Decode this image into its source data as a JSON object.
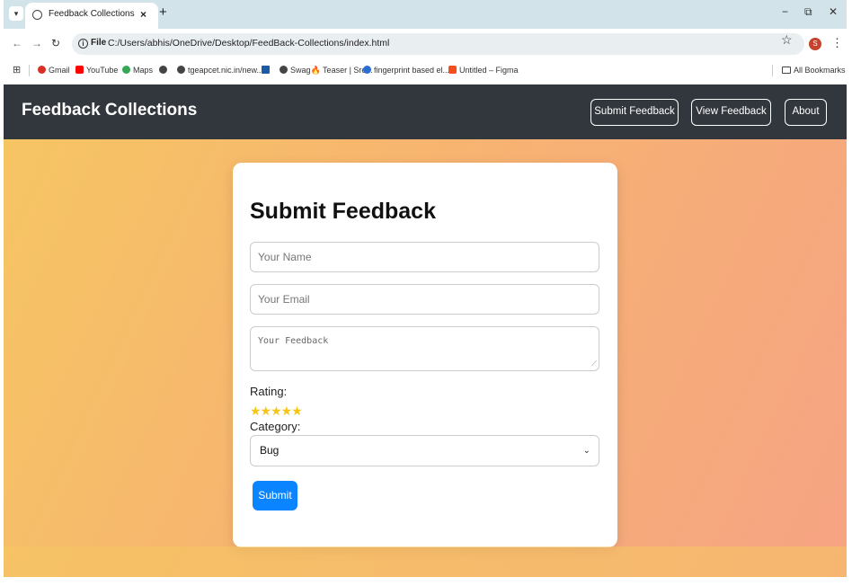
{
  "browser": {
    "tab_title": "Feedback Collections",
    "tab_close": "×",
    "new_tab": "+",
    "url_scheme_label": "File",
    "url": "C:/Users/abhis/OneDrive/Desktop/FeedBack-Collections/index.html",
    "profile_initial": "S",
    "window_controls": {
      "minimize": "−",
      "restore": "⧉",
      "close": "✕"
    },
    "bookmarks": [
      {
        "label": "Gmail",
        "icon": "gmail-icon",
        "color": "#d93025"
      },
      {
        "label": "YouTube",
        "icon": "youtube-icon",
        "color": "#ff0000"
      },
      {
        "label": "Maps",
        "icon": "maps-icon",
        "color": "#34a853"
      },
      {
        "label": "",
        "icon": "globe-icon",
        "color": "#444444"
      },
      {
        "label": "tgeapcet.nic.in/new...",
        "icon": "globe-icon",
        "color": "#444444"
      },
      {
        "label": "",
        "icon": "bookmark-icon",
        "color": "#1a5aa6"
      },
      {
        "label": "Swag🔥 Teaser | Sre...",
        "icon": "globe-icon",
        "color": "#444444"
      },
      {
        "label": "fingerprint based el...",
        "icon": "edge-icon",
        "color": "#2a6ed1"
      },
      {
        "label": "Untitled – Figma",
        "icon": "figma-icon",
        "color": "#f24e1e"
      }
    ],
    "all_bookmarks": "All Bookmarks"
  },
  "site": {
    "title": "Feedback Collections",
    "nav": {
      "submit_feedback": "Submit Feedback",
      "view_feedback": "View Feedback",
      "about": "About"
    }
  },
  "form": {
    "heading": "Submit Feedback",
    "name_placeholder": "Your Name",
    "email_placeholder": "Your Email",
    "feedback_placeholder": "Your Feedback",
    "rating_label": "Rating:",
    "rating_stars": "★★★★★",
    "rating_value": 5,
    "category_label": "Category:",
    "category_selected": "Bug",
    "submit_label": "Submit"
  },
  "colors": {
    "header_bg": "#32373d",
    "submit_bg": "#0b84ff",
    "star": "#f5c518",
    "gradient_start": "#f6c662",
    "gradient_end": "#f6a383"
  }
}
